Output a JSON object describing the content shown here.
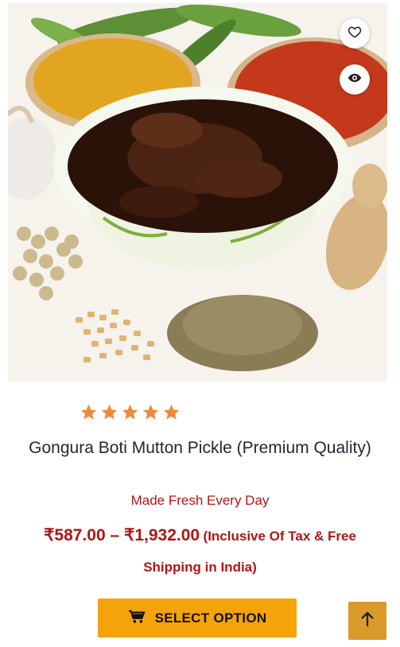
{
  "product": {
    "title": "Gongura Boti Mutton Pickle (Premium Quality)",
    "subtitle": "Made Fresh Every Day",
    "price_range": "₹587.00 – ₹1,932.00",
    "price_note": "(Inclusive Of Tax & Free Shipping in India)",
    "rating": 5,
    "rating_max": 5
  },
  "actions": {
    "select_option_label": "SELECT OPTION"
  },
  "icons": {
    "wishlist": "heart-icon",
    "quickview": "eye-icon",
    "cart": "cart-icon",
    "scroll_top": "arrow-up-icon"
  },
  "colors": {
    "price": "#b01616",
    "star": "#f0883a",
    "button": "#f5a30a",
    "scroll_top": "#d99a2a"
  }
}
